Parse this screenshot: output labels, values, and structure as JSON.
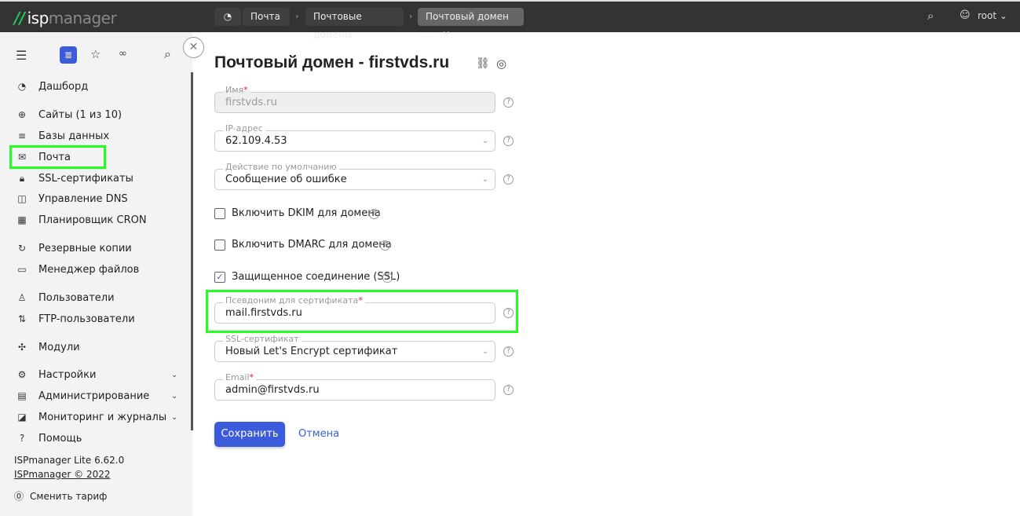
{
  "header": {
    "logo_prefix": "isp",
    "logo_suffix": "manager",
    "breadcrumbs": [
      "Почта",
      "Почтовые домены",
      "Почтовый домен ..."
    ],
    "user": "root"
  },
  "sidebar": {
    "items": [
      {
        "label": "Дашборд",
        "icon": "dashboard-icon"
      },
      {
        "label": "Сайты (1 из 10)",
        "icon": "globe-icon"
      },
      {
        "label": "Базы данных",
        "icon": "database-icon"
      },
      {
        "label": "Почта",
        "icon": "mail-icon"
      },
      {
        "label": "SSL-сертификаты",
        "icon": "lock-icon"
      },
      {
        "label": "Управление DNS",
        "icon": "dns-icon"
      },
      {
        "label": "Планировщик CRON",
        "icon": "calendar-icon"
      },
      {
        "label": "Резервные копии",
        "icon": "backup-icon"
      },
      {
        "label": "Менеджер файлов",
        "icon": "folder-icon"
      },
      {
        "label": "Пользователи",
        "icon": "user-icon"
      },
      {
        "label": "FTP-пользователи",
        "icon": "ftp-icon"
      },
      {
        "label": "Модули",
        "icon": "puzzle-icon"
      },
      {
        "label": "Настройки",
        "icon": "settings-icon"
      },
      {
        "label": "Администрирование",
        "icon": "admin-icon"
      },
      {
        "label": "Мониторинг и журналы",
        "icon": "monitor-icon"
      },
      {
        "label": "Помощь",
        "icon": "help-icon"
      }
    ],
    "version": "ISPmanager Lite 6.62.0",
    "copyright": "ISPmanager © 2022",
    "change_plan": "Сменить тариф"
  },
  "form": {
    "title": "Почтовый домен - firstvds.ru",
    "name_label": "Имя",
    "name_value": "firstvds.ru",
    "ip_label": "IP-адрес",
    "ip_value": "62.109.4.53",
    "action_label": "Действие по умолчанию",
    "action_value": "Сообщение об ошибке",
    "dkim_label": "Включить DKIM для домена",
    "dkim_checked": false,
    "dmarc_label": "Включить DMARC для домена",
    "dmarc_checked": false,
    "ssl_label": "Защищенное соединение (SSL)",
    "ssl_checked": true,
    "alias_label": "Псевдоним для сертификата",
    "alias_value": "mail.firstvds.ru",
    "cert_label": "SSL-сертификат",
    "cert_value": "Новый Let's Encrypt сертификат",
    "email_label": "Email",
    "email_value": "admin@firstvds.ru",
    "save": "Сохранить",
    "cancel": "Отмена"
  },
  "colors": {
    "accent": "#3b5bdb",
    "highlight": "#22ff22",
    "topbar": "#333333"
  }
}
